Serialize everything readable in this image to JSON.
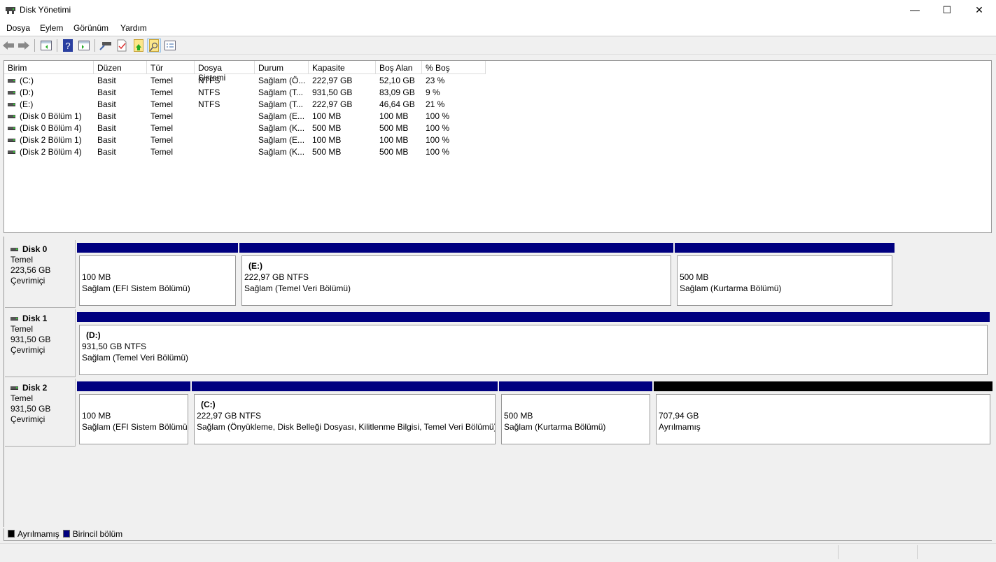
{
  "window": {
    "title": "Disk Yönetimi",
    "minimize": "—",
    "maximize": "☐",
    "close": "✕"
  },
  "menu": [
    "Dosya",
    "Eylem",
    "Görünüm",
    "Yardım"
  ],
  "toolbar": [
    "back-icon",
    "forward-icon",
    "show-hide-console-tree-icon",
    "help-icon",
    "show-hide-action-pane-icon",
    "connect-disk-icon",
    "check-properties-icon",
    "up-folder-icon",
    "find-icon",
    "list-view-icon"
  ],
  "volumes": {
    "columns": [
      "Birim",
      "Düzen",
      "Tür",
      "Dosya Sistemi",
      "Durum",
      "Kapasite",
      "Boş Alan",
      "% Boş"
    ],
    "rows": [
      [
        "(C:)",
        "Basit",
        "Temel",
        "NTFS",
        "Sağlam (Ö...",
        "222,97 GB",
        "52,10 GB",
        "23 %"
      ],
      [
        "(D:)",
        "Basit",
        "Temel",
        "NTFS",
        "Sağlam (T...",
        "931,50 GB",
        "83,09 GB",
        "9 %"
      ],
      [
        "(E:)",
        "Basit",
        "Temel",
        "NTFS",
        "Sağlam (T...",
        "222,97 GB",
        "46,64 GB",
        "21 %"
      ],
      [
        "(Disk 0 Bölüm 1)",
        "Basit",
        "Temel",
        "",
        "Sağlam (E...",
        "100 MB",
        "100 MB",
        "100 %"
      ],
      [
        "(Disk 0 Bölüm 4)",
        "Basit",
        "Temel",
        "",
        "Sağlam (K...",
        "500 MB",
        "500 MB",
        "100 %"
      ],
      [
        "(Disk 2 Bölüm 1)",
        "Basit",
        "Temel",
        "",
        "Sağlam (E...",
        "100 MB",
        "100 MB",
        "100 %"
      ],
      [
        "(Disk 2 Bölüm 4)",
        "Basit",
        "Temel",
        "",
        "Sağlam (K...",
        "500 MB",
        "500 MB",
        "100 %"
      ]
    ]
  },
  "disks": [
    {
      "name": "Disk 0",
      "type": "Temel",
      "size": "223,56 GB",
      "status": "Çevrimiçi",
      "partitions": [
        {
          "label": "",
          "size": "100 MB",
          "status": "Sağlam (EFI Sistem Bölümü)",
          "kind": "primary"
        },
        {
          "label": "(E:)",
          "size": "222,97 GB NTFS",
          "status": "Sağlam (Temel Veri Bölümü)",
          "kind": "primary"
        },
        {
          "label": "",
          "size": "500 MB",
          "status": "Sağlam (Kurtarma Bölümü)",
          "kind": "primary"
        }
      ]
    },
    {
      "name": "Disk 1",
      "type": "Temel",
      "size": "931,50 GB",
      "status": "Çevrimiçi",
      "partitions": [
        {
          "label": "(D:)",
          "size": "931,50 GB NTFS",
          "status": "Sağlam (Temel Veri Bölümü)",
          "kind": "primary"
        }
      ]
    },
    {
      "name": "Disk 2",
      "type": "Temel",
      "size": "931,50 GB",
      "status": "Çevrimiçi",
      "partitions": [
        {
          "label": "",
          "size": "100 MB",
          "status": "Sağlam (EFI Sistem Bölümü)",
          "kind": "primary"
        },
        {
          "label": "(C:)",
          "size": "222,97 GB NTFS",
          "status": "Sağlam (Önyükleme, Disk Belleği Dosyası, Kilitlenme Bilgisi, Temel Veri Bölümü)",
          "kind": "primary"
        },
        {
          "label": "",
          "size": "500 MB",
          "status": "Sağlam (Kurtarma Bölümü)",
          "kind": "primary"
        },
        {
          "label": "",
          "size": "707,94 GB",
          "status": "Ayrılmamış",
          "kind": "unallocated"
        }
      ]
    }
  ],
  "legend": [
    {
      "label": "Ayrılmamış",
      "color": "#000000"
    },
    {
      "label": "Birincil bölüm",
      "color": "#000080"
    }
  ]
}
